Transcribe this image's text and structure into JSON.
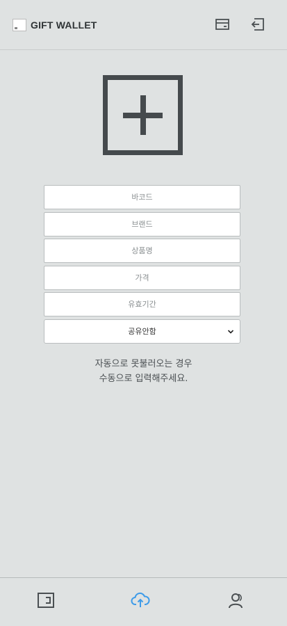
{
  "header": {
    "title": "GIFT WALLET",
    "icons": [
      "card-icon",
      "logout-icon"
    ]
  },
  "form": {
    "barcode_placeholder": "바코드",
    "brand_placeholder": "브랜드",
    "product_placeholder": "상품명",
    "price_placeholder": "가격",
    "expiry_placeholder": "유효기간",
    "share_selected": "공유안함"
  },
  "notice": {
    "line1": "자동으로 못불러오는 경우",
    "line2": "수동으로 입력해주세요."
  },
  "bottom_nav": {
    "items": [
      "wallet-icon",
      "upload-icon",
      "profile-icon"
    ],
    "active": "upload-icon",
    "active_color": "#3d9be9",
    "inactive_color": "#4a4f52"
  }
}
